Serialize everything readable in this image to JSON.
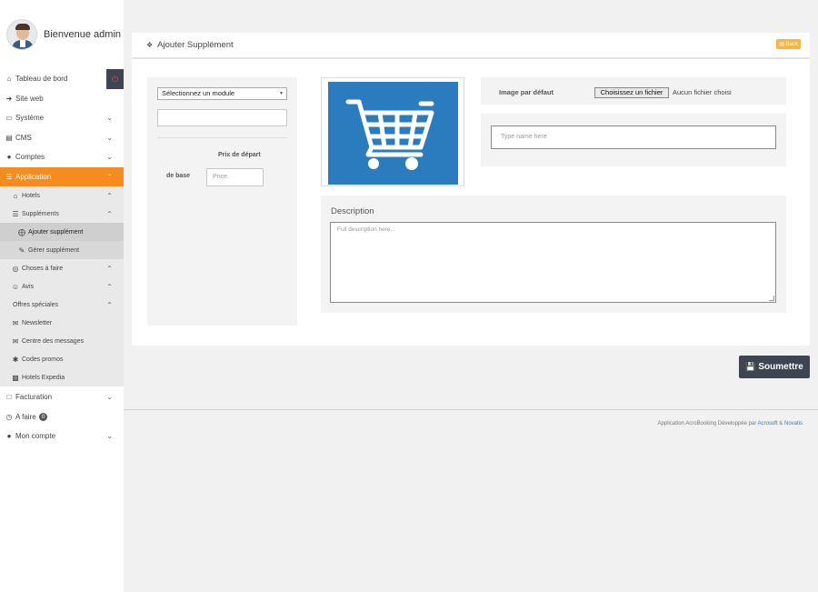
{
  "profile": {
    "welcome": "Bienvenue admin"
  },
  "sidebar": {
    "dashboard": "Tableau de bord",
    "website": "Site web",
    "system": "Système",
    "cms": "CMS",
    "accounts": "Comptes",
    "application": "Application",
    "hotels": "Hotels",
    "supplements": "Suppléments",
    "add_supplement": "Ajouter supplément",
    "manage_supplement": "Gérer supplément",
    "things_to_do": "Choses à faire",
    "reviews": "Avis",
    "special_offers": "Offres spéciales",
    "newsletter": "Newsletter",
    "message_center": "Centre des messages",
    "promo_codes": "Codes promos",
    "expedia_hotels": "Hotels Expedia",
    "billing": "Facturation",
    "todo": "A faire",
    "todo_count": "0",
    "my_account": "Mon compte"
  },
  "panel": {
    "title": "Ajouter Supplément",
    "back_label": "Back"
  },
  "form": {
    "module_select": "Sélectionnez un module",
    "start_price_label": "Prix de départ",
    "base_label": "de base",
    "price_placeholder": "Price",
    "default_image_label": "Image par défaut",
    "file_button": "Choisissez un fichier",
    "file_none": "Aucun fichier choisi",
    "name_placeholder": "Type name here",
    "description_label": "Description",
    "description_placeholder": "Full description here..."
  },
  "submit_label": "Soumettre",
  "footer": {
    "text": "Application AcroBooking Développée par",
    "link1": "Acrosoft",
    "amp": "&",
    "link2": "Novatis"
  },
  "colors": {
    "accent": "#f68b1f",
    "dark": "#3e4452",
    "image_bg": "#2b7bbf",
    "back_button": "#f7b541"
  }
}
